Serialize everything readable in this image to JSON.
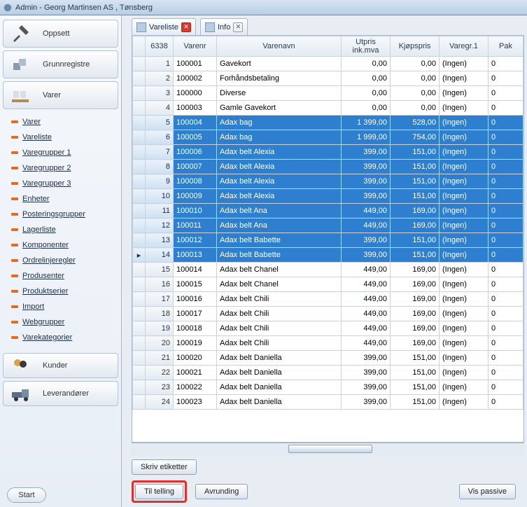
{
  "window": {
    "title": "Admin - Georg Martinsen AS , Tønsberg"
  },
  "sidebar": {
    "oppsett": "Oppsett",
    "grunnregistre": "Grunnregistre",
    "varer": "Varer",
    "kunder": "Kunder",
    "leverandorer": "Leverandører",
    "start": "Start",
    "items": [
      "Varer",
      "Vareliste",
      "Varegrupper 1",
      "Varegrupper 2",
      "Varegrupper 3",
      "Enheter",
      "Posteringsgrupper",
      "Lagerliste",
      "Komponenter",
      "Ordrelinjeregler",
      "Produsenter",
      "Produktserier",
      "Import",
      "Webgrupper",
      "Varekategorier"
    ]
  },
  "tabs": {
    "vareliste": "Vareliste",
    "info": "Info"
  },
  "grid": {
    "countCell": "6338",
    "headers": {
      "varenr": "Varenr",
      "varenavn": "Varenavn",
      "utpris": "Utpris",
      "utpris2": "ink.mva",
      "kjopspris": "Kjøpspris",
      "varegr": "Varegr.1",
      "pak": "Pak"
    },
    "rows": [
      {
        "n": 1,
        "nr": "100001",
        "navn": "Gavekort",
        "ut": "0,00",
        "kj": "0,00",
        "gr": "(Ingen)",
        "pk": "0",
        "sel": false
      },
      {
        "n": 2,
        "nr": "100002",
        "navn": "Forhåndsbetaling",
        "ut": "0,00",
        "kj": "0,00",
        "gr": "(Ingen)",
        "pk": "0",
        "sel": false
      },
      {
        "n": 3,
        "nr": "100000",
        "navn": "Diverse",
        "ut": "0,00",
        "kj": "0,00",
        "gr": "(Ingen)",
        "pk": "0",
        "sel": false
      },
      {
        "n": 4,
        "nr": "100003",
        "navn": "Gamle Gavekort",
        "ut": "0,00",
        "kj": "0,00",
        "gr": "(Ingen)",
        "pk": "0",
        "sel": false
      },
      {
        "n": 5,
        "nr": "100004",
        "navn": "Adax bag",
        "ut": "1 399,00",
        "kj": "528,00",
        "gr": "(Ingen)",
        "pk": "0",
        "sel": true
      },
      {
        "n": 6,
        "nr": "100005",
        "navn": "Adax bag",
        "ut": "1 999,00",
        "kj": "754,00",
        "gr": "(Ingen)",
        "pk": "0",
        "sel": true
      },
      {
        "n": 7,
        "nr": "100006",
        "navn": "Adax belt Alexia",
        "ut": "399,00",
        "kj": "151,00",
        "gr": "(Ingen)",
        "pk": "0",
        "sel": true
      },
      {
        "n": 8,
        "nr": "100007",
        "navn": "Adax belt Alexia",
        "ut": "399,00",
        "kj": "151,00",
        "gr": "(Ingen)",
        "pk": "0",
        "sel": true
      },
      {
        "n": 9,
        "nr": "100008",
        "navn": "Adax belt Alexia",
        "ut": "399,00",
        "kj": "151,00",
        "gr": "(Ingen)",
        "pk": "0",
        "sel": true
      },
      {
        "n": 10,
        "nr": "100009",
        "navn": "Adax belt Alexia",
        "ut": "399,00",
        "kj": "151,00",
        "gr": "(Ingen)",
        "pk": "0",
        "sel": true
      },
      {
        "n": 11,
        "nr": "100010",
        "navn": "Adax belt Ana",
        "ut": "449,00",
        "kj": "169,00",
        "gr": "(Ingen)",
        "pk": "0",
        "sel": true
      },
      {
        "n": 12,
        "nr": "100011",
        "navn": "Adax belt Ana",
        "ut": "449,00",
        "kj": "169,00",
        "gr": "(Ingen)",
        "pk": "0",
        "sel": true
      },
      {
        "n": 13,
        "nr": "100012",
        "navn": "Adax belt Babette",
        "ut": "399,00",
        "kj": "151,00",
        "gr": "(Ingen)",
        "pk": "0",
        "sel": true
      },
      {
        "n": 14,
        "nr": "100013",
        "navn": "Adax belt Babette",
        "ut": "399,00",
        "kj": "151,00",
        "gr": "(Ingen)",
        "pk": "0",
        "sel": true,
        "cur": true
      },
      {
        "n": 15,
        "nr": "100014",
        "navn": "Adax belt Chanel",
        "ut": "449,00",
        "kj": "169,00",
        "gr": "(Ingen)",
        "pk": "0",
        "sel": false
      },
      {
        "n": 16,
        "nr": "100015",
        "navn": "Adax belt Chanel",
        "ut": "449,00",
        "kj": "169,00",
        "gr": "(Ingen)",
        "pk": "0",
        "sel": false
      },
      {
        "n": 17,
        "nr": "100016",
        "navn": "Adax belt Chili",
        "ut": "449,00",
        "kj": "169,00",
        "gr": "(Ingen)",
        "pk": "0",
        "sel": false
      },
      {
        "n": 18,
        "nr": "100017",
        "navn": "Adax belt Chili",
        "ut": "449,00",
        "kj": "169,00",
        "gr": "(Ingen)",
        "pk": "0",
        "sel": false
      },
      {
        "n": 19,
        "nr": "100018",
        "navn": "Adax belt Chili",
        "ut": "449,00",
        "kj": "169,00",
        "gr": "(Ingen)",
        "pk": "0",
        "sel": false
      },
      {
        "n": 20,
        "nr": "100019",
        "navn": "Adax belt Chili",
        "ut": "449,00",
        "kj": "169,00",
        "gr": "(Ingen)",
        "pk": "0",
        "sel": false
      },
      {
        "n": 21,
        "nr": "100020",
        "navn": "Adax belt Daniella",
        "ut": "399,00",
        "kj": "151,00",
        "gr": "(Ingen)",
        "pk": "0",
        "sel": false
      },
      {
        "n": 22,
        "nr": "100021",
        "navn": "Adax belt Daniella",
        "ut": "399,00",
        "kj": "151,00",
        "gr": "(Ingen)",
        "pk": "0",
        "sel": false
      },
      {
        "n": 23,
        "nr": "100022",
        "navn": "Adax belt Daniella",
        "ut": "399,00",
        "kj": "151,00",
        "gr": "(Ingen)",
        "pk": "0",
        "sel": false
      },
      {
        "n": 24,
        "nr": "100023",
        "navn": "Adax belt Daniella",
        "ut": "399,00",
        "kj": "151,00",
        "gr": "(Ingen)",
        "pk": "0",
        "sel": false
      }
    ]
  },
  "buttons": {
    "skriv": "Skriv etiketter",
    "tiltelling": "Til telling",
    "avrunding": "Avrunding",
    "vispassive": "Vis passive"
  }
}
